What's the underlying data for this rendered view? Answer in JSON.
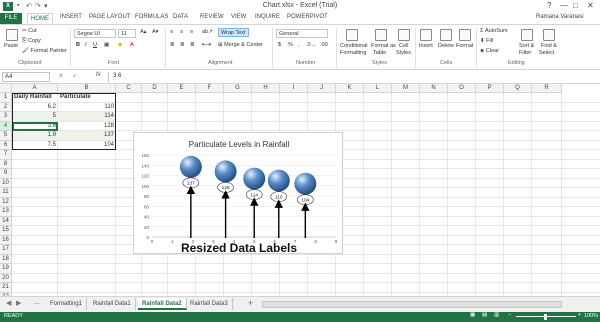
{
  "window": {
    "title": "Chart.xlsx - Excel (Trial)",
    "app_badge": "X",
    "controls": [
      "?",
      "—",
      "□",
      "✕"
    ]
  },
  "ribbon_tabs": {
    "file": "FILE",
    "tabs": [
      "HOME",
      "INSERT",
      "PAGE LAYOUT",
      "FORMULAS",
      "DATA",
      "REVIEW",
      "VIEW",
      "INQUIRE",
      "POWERPIVOT"
    ],
    "active": "HOME",
    "user": "Ramana Varanasi"
  },
  "ribbon": {
    "clipboard": {
      "paste": "Paste",
      "cut": "Cut",
      "copy": "Copy",
      "format_painter": "Format Painter",
      "label": "Clipboard"
    },
    "font": {
      "name": "Segoe UI",
      "size": "11",
      "bold": "B",
      "italic": "I",
      "underline": "U",
      "label": "Font"
    },
    "alignment": {
      "wrap_text": "Wrap Text",
      "merge_center": "Merge & Center",
      "label": "Alignment"
    },
    "number": {
      "format": "General",
      "currency": "$",
      "percent": "%",
      "comma": ",",
      "label": "Number"
    },
    "styles": {
      "conditional": "Conditional",
      "conditional2": "Formatting",
      "format_as": "Format as",
      "format_as2": "Table",
      "cell": "Cell",
      "cell2": "Styles",
      "label": "Styles"
    },
    "cells": {
      "insert": "Insert",
      "delete": "Delete",
      "format": "Format",
      "label": "Cells"
    },
    "editing": {
      "autosum": "AutoSum",
      "fill": "Fill",
      "clear": "Clear",
      "sort": "Sort &",
      "sort2": "Filter",
      "find": "Find &",
      "find2": "Select",
      "label": "Editing"
    }
  },
  "formula_bar": {
    "name_box": "A4",
    "fx": "fx",
    "value": "3.6"
  },
  "grid": {
    "columns": [
      "A",
      "B",
      "C",
      "D",
      "E",
      "F",
      "G",
      "H",
      "I",
      "J",
      "K",
      "L",
      "M",
      "N",
      "O",
      "P",
      "Q",
      "R"
    ],
    "rows": [
      "1",
      "2",
      "3",
      "4",
      "5",
      "6",
      "7",
      "8",
      "9",
      "10",
      "11",
      "12",
      "13",
      "14",
      "15",
      "16",
      "17",
      "18",
      "19",
      "20",
      "21",
      "22"
    ],
    "headers": [
      "Daily Rainfall",
      "Particulate"
    ],
    "data": [
      [
        "6.2",
        "110"
      ],
      [
        "5",
        "114"
      ],
      [
        "3.6",
        "128"
      ],
      [
        "1.9",
        "137"
      ],
      [
        "7.5",
        "104"
      ]
    ]
  },
  "chart_data": {
    "type": "scatter",
    "title": "Particulate Levels in Rainfall",
    "xlim": [
      0,
      9
    ],
    "ylim": [
      0,
      160
    ],
    "x_ticks": [
      "0",
      "1",
      "2",
      "3",
      "4",
      "5",
      "6",
      "7",
      "8",
      "9"
    ],
    "y_ticks": [
      "0",
      "20",
      "40",
      "60",
      "80",
      "100",
      "120",
      "140",
      "160"
    ],
    "points": [
      {
        "x": 1.9,
        "y": 137
      },
      {
        "x": 3.6,
        "y": 128
      },
      {
        "x": 5,
        "y": 114
      },
      {
        "x": 6.2,
        "y": 110
      },
      {
        "x": 7.5,
        "y": 104
      }
    ],
    "data_labels": [
      "137",
      "128",
      "114",
      "110",
      "104"
    ],
    "marker_color": "#5b8fc9"
  },
  "annotation": {
    "text": "Resized Data Labels"
  },
  "sheet_tabs": {
    "nav": [
      "◀",
      "▶",
      "..."
    ],
    "tabs": [
      "Formatting1",
      "Rainfall Data1",
      "Rainfall Data2",
      "Rainfall Data3"
    ],
    "active": "Rainfall Data2",
    "add": "+"
  },
  "status": {
    "ready": "READY",
    "zoom": "100%"
  }
}
